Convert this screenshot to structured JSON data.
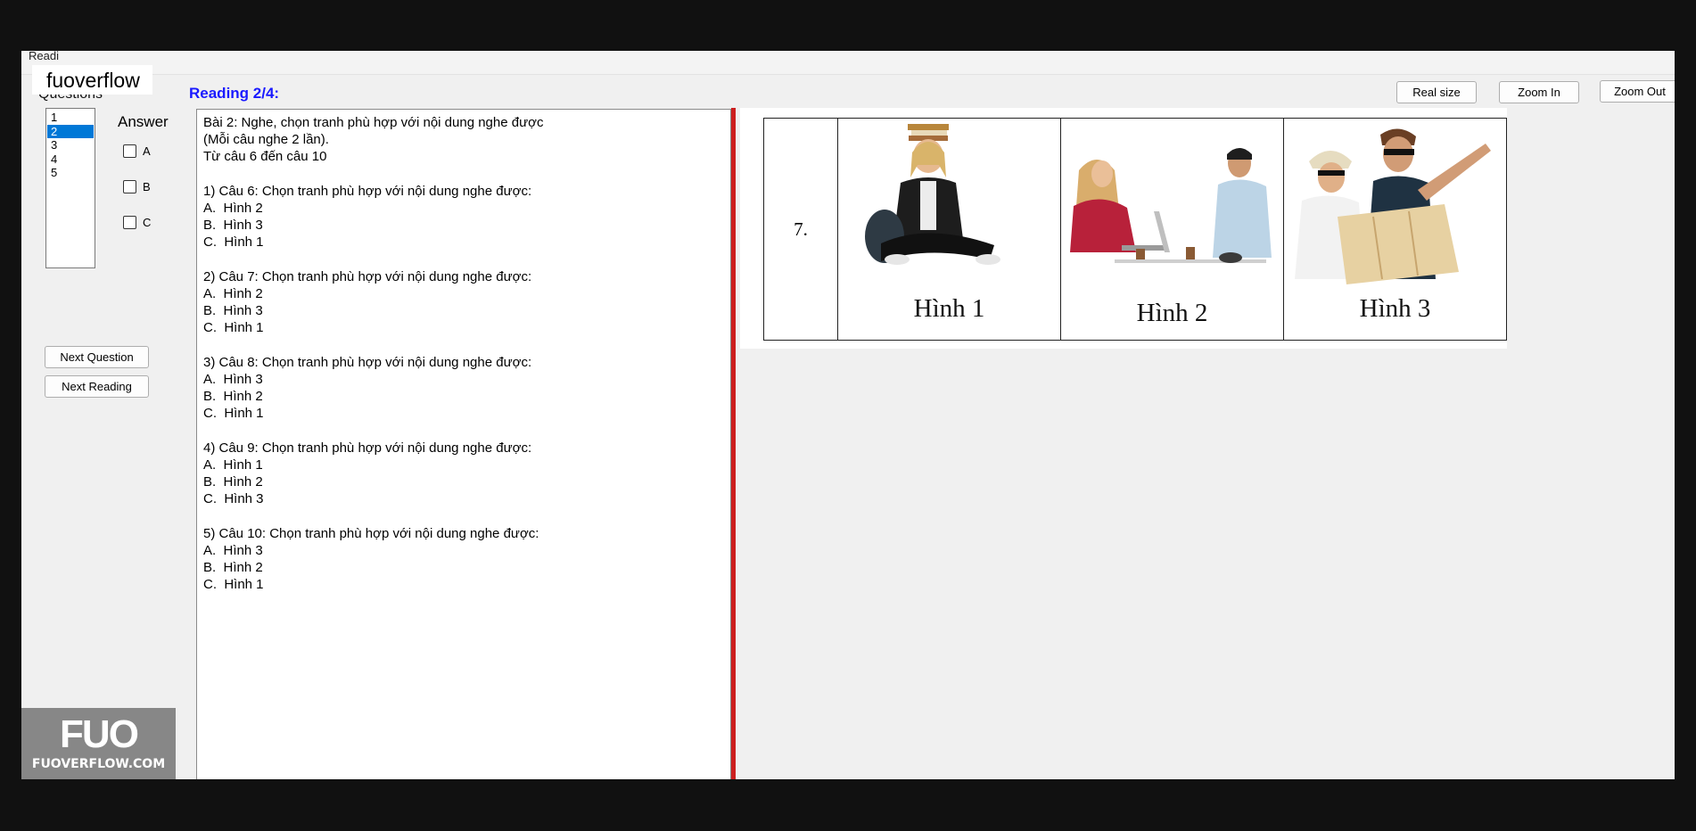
{
  "menu": {
    "partial_label": "Readi"
  },
  "watermark_top": "fuoverflow",
  "sidebar": {
    "questions_label": "Questions",
    "question_items": [
      "1",
      "2",
      "3",
      "4",
      "5"
    ],
    "selected_index": 1,
    "answer_label": "Answer",
    "options": [
      "A",
      "B",
      "C"
    ],
    "next_question_label": "Next Question",
    "next_reading_label": "Next Reading"
  },
  "reading": {
    "title": "Reading 2/4:",
    "intro": [
      "Bài 2: Nghe, chọn tranh phù hợp với nội dung nghe được",
      "(Mỗi câu nghe 2 lần).",
      "Từ câu 6 đến câu 10"
    ],
    "questions": [
      {
        "prompt": "1) Câu 6: Chọn tranh phù hợp với nội dung nghe được:",
        "choices": [
          "A.  Hình 2",
          "B.  Hình 3",
          "C.  Hình 1"
        ]
      },
      {
        "prompt": "2) Câu 7: Chọn tranh phù hợp với nội dung nghe được:",
        "choices": [
          "A.  Hình 2",
          "B.  Hình 3",
          "C.  Hình 1"
        ]
      },
      {
        "prompt": "3) Câu 8: Chọn tranh phù hợp với nội dung nghe được:",
        "choices": [
          "A.  Hình 3",
          "B.  Hình 2",
          "C.  Hình 1"
        ]
      },
      {
        "prompt": "4) Câu 9: Chọn tranh phù hợp với nội dung nghe được:",
        "choices": [
          "A.  Hình 1",
          "B.  Hình 2",
          "C.  Hình 3"
        ]
      },
      {
        "prompt": "5) Câu 10: Chọn tranh phù hợp với nội dung nghe được:",
        "choices": [
          "A.  Hình 3",
          "B.  Hình 2",
          "C.  Hình 1"
        ]
      }
    ]
  },
  "image_toolbar": {
    "real_size": "Real size",
    "zoom_in": "Zoom In",
    "zoom_out": "Zoom Out"
  },
  "question_image": {
    "number": "7.",
    "pictures": [
      {
        "label": "Hình 1",
        "description_icon": "student-sitting-books-on-head"
      },
      {
        "label": "Hình 2",
        "description_icon": "two-people-working-laptop"
      },
      {
        "label": "Hình 3",
        "description_icon": "tourists-with-map"
      }
    ]
  },
  "logo": {
    "mark": "FUO",
    "site": "FUOVERFLOW.COM"
  },
  "colors": {
    "accent_blue": "#1a1aff",
    "selection": "#0078d7",
    "divider_red": "#cc1f1f"
  }
}
